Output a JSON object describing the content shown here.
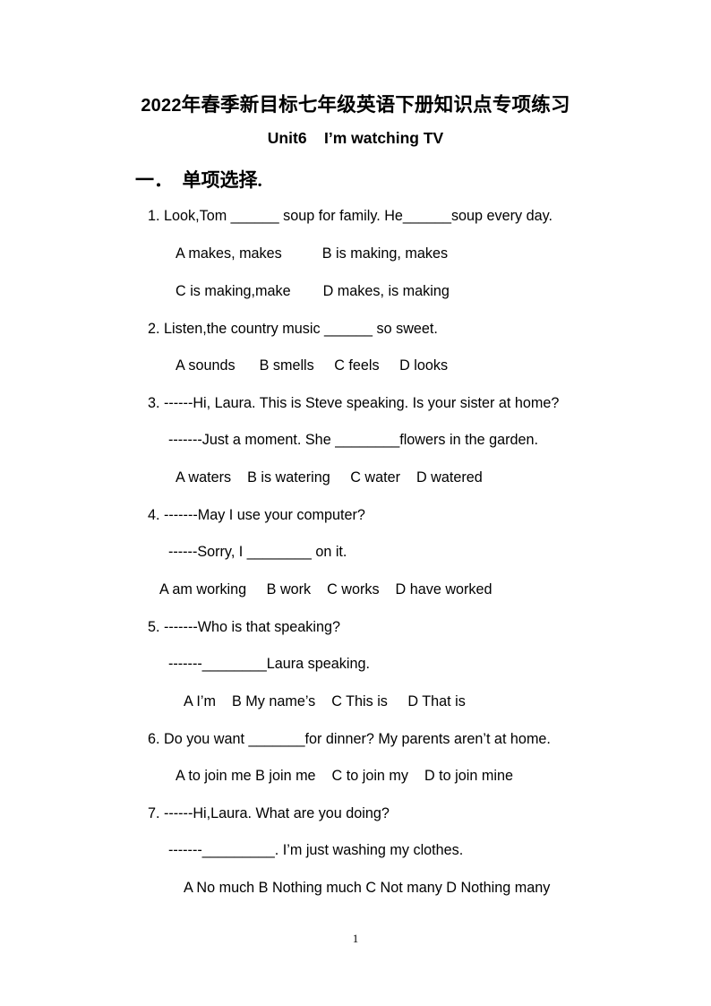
{
  "document": {
    "title": "2022年春季新目标七年级英语下册知识点专项练习",
    "title_year": "2022",
    "title_rest": "年春季新目标七年级英语下册知识点专项练习",
    "unit_heading": "Unit6    I’m watching TV",
    "section_heading": "一．  单项选择.",
    "page_number": "1"
  },
  "questions": [
    {
      "number": "1",
      "stem": "1. Look,Tom ______ soup for family. He______soup every day.",
      "lines": [],
      "options": [
        "A makes, makes          B is making, makes",
        "C is making,make        D makes, is making"
      ]
    },
    {
      "number": "2",
      "stem": "2. Listen,the country music ______ so sweet.",
      "lines": [],
      "options": [
        "A sounds      B smells     C feels     D looks"
      ]
    },
    {
      "number": "3",
      "stem": "3. ------Hi, Laura. This is Steve speaking. Is your sister at home?",
      "lines": [
        "-------Just a moment. She ________flowers in the garden."
      ],
      "options": [
        "A waters    B is watering     C water    D watered"
      ]
    },
    {
      "number": "4",
      "stem": "4. -------May I use your computer?",
      "lines": [
        "------Sorry, I ________ on it."
      ],
      "options": [
        "A am working     B work    C works    D have worked"
      ]
    },
    {
      "number": "5",
      "stem": "5. -------Who is that speaking?",
      "lines": [
        "-------________Laura speaking."
      ],
      "options": [
        "A I’m    B My name’s    C This is     D That is"
      ]
    },
    {
      "number": "6",
      "stem": "6. Do you want _______for dinner? My parents aren’t at home.",
      "lines": [],
      "options": [
        "A to join me B join me    C to join my    D to join mine"
      ]
    },
    {
      "number": "7",
      "stem": "7. ------Hi,Laura. What are you doing?",
      "lines": [
        "-------_________. I’m just washing my clothes."
      ],
      "options": [
        "A No much B Nothing much C Not many D Nothing many"
      ]
    }
  ]
}
